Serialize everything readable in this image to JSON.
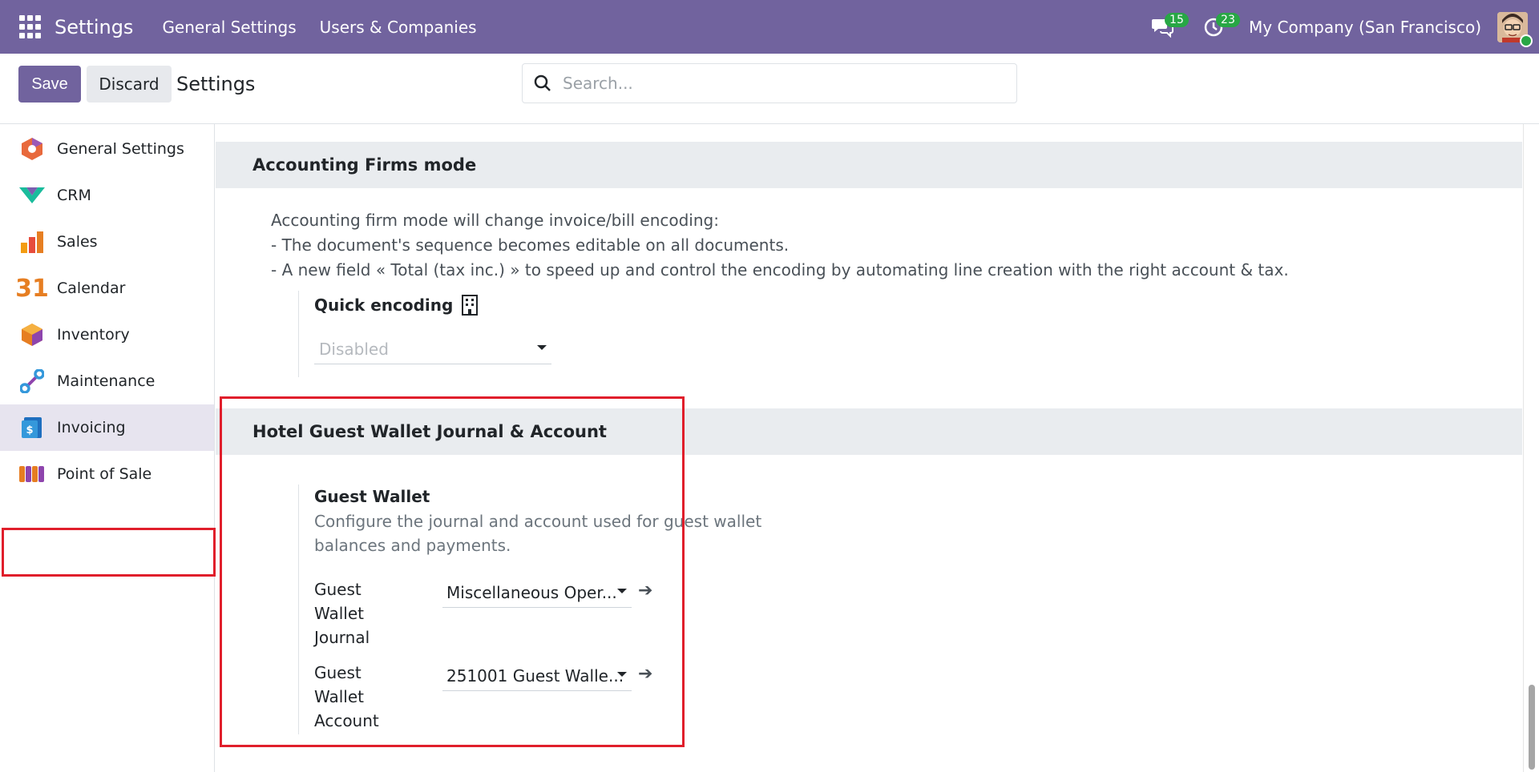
{
  "navbar": {
    "brand": "Settings",
    "menus": [
      "General Settings",
      "Users & Companies"
    ],
    "messages_count": "15",
    "activities_count": "23",
    "company": "My Company (San Francisco)"
  },
  "control_panel": {
    "save_label": "Save",
    "discard_label": "Discard",
    "title": "Settings",
    "search_placeholder": "Search..."
  },
  "sidebar": {
    "items": [
      {
        "label": "General Settings",
        "icon": "general-settings-icon"
      },
      {
        "label": "CRM",
        "icon": "crm-icon"
      },
      {
        "label": "Sales",
        "icon": "sales-icon"
      },
      {
        "label": "Calendar",
        "icon": "calendar-icon",
        "icon_text": "31"
      },
      {
        "label": "Inventory",
        "icon": "inventory-icon"
      },
      {
        "label": "Maintenance",
        "icon": "maintenance-icon"
      },
      {
        "label": "Invoicing",
        "icon": "invoicing-icon",
        "active": true
      },
      {
        "label": "Point of Sale",
        "icon": "point-of-sale-icon"
      }
    ]
  },
  "sections": {
    "accounting_firms": {
      "title": "Accounting Firms mode",
      "description": [
        "Accounting firm mode will change invoice/bill encoding:",
        "- The document's sequence becomes editable on all documents.",
        "- A new field « Total (tax inc.) » to speed up and control the encoding by automating line creation with the right account & tax."
      ],
      "quick_encoding": {
        "label": "Quick encoding",
        "value": "Disabled"
      }
    },
    "hotel_wallet": {
      "title": "Hotel Guest Wallet Journal & Account",
      "setting_title": "Guest Wallet",
      "setting_desc": "Configure the journal and account used for guest wallet balances and payments.",
      "fields": [
        {
          "label": "Guest Wallet Journal",
          "value": "Miscellaneous Oper..."
        },
        {
          "label": "Guest Wallet Account",
          "value": "251001 Guest Walle..."
        }
      ]
    }
  },
  "colors": {
    "brand": "#71639e",
    "highlight": "#e01e2b",
    "badge": "#28a745"
  }
}
